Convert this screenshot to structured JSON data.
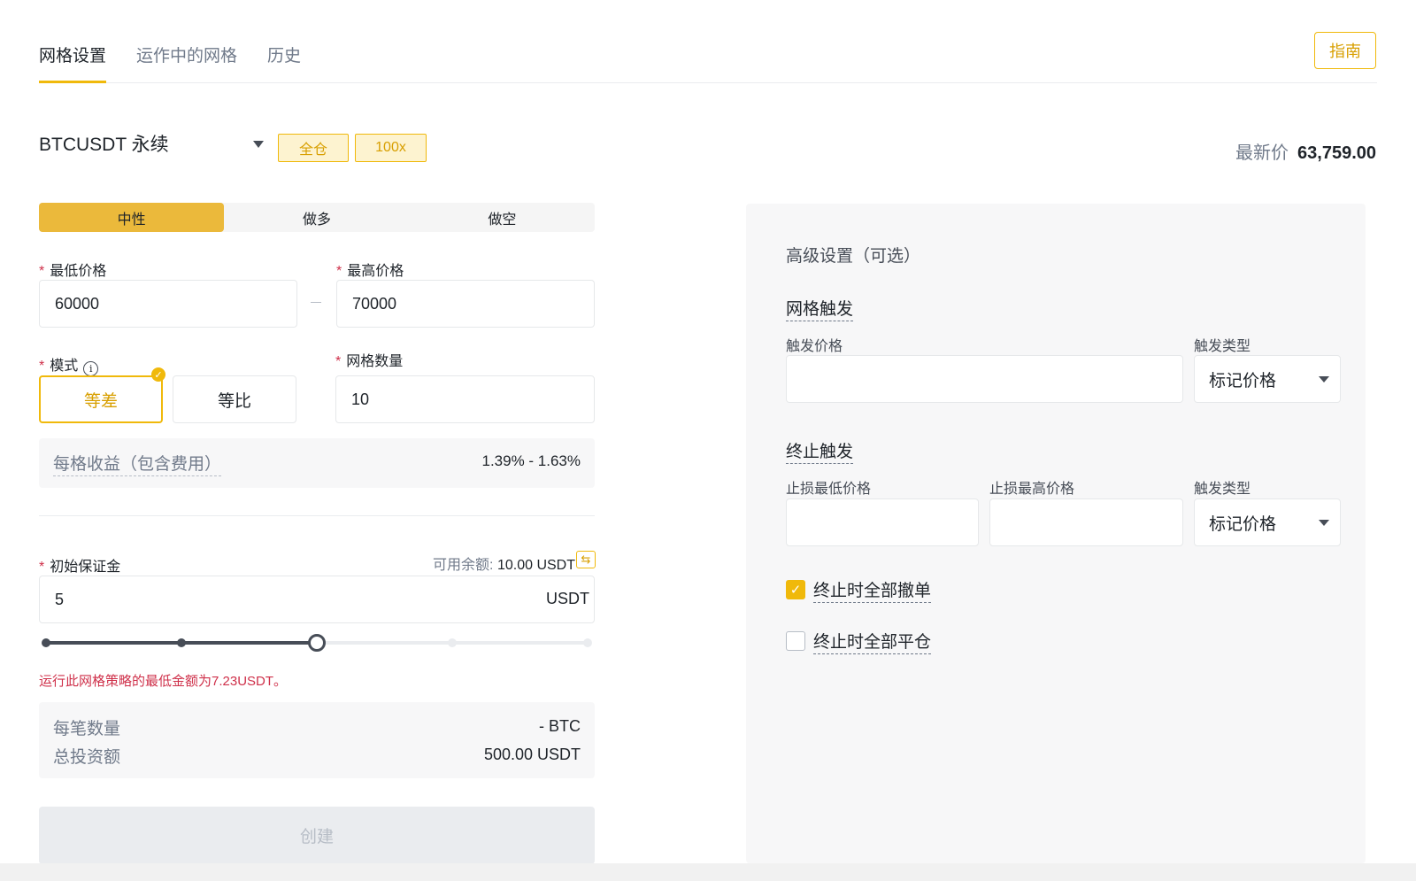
{
  "tabs": [
    {
      "label": "网格设置"
    },
    {
      "label": "运作中的网格"
    },
    {
      "label": "历史"
    }
  ],
  "guide_button": "指南",
  "symbol": {
    "name": "BTCUSDT 永续",
    "margin_mode": "全仓",
    "leverage": "100x"
  },
  "last_price": {
    "label": "最新价",
    "value": "63,759.00"
  },
  "direction": [
    {
      "label": "中性",
      "active": true
    },
    {
      "label": "做多",
      "active": false
    },
    {
      "label": "做空",
      "active": false
    }
  ],
  "price_range": {
    "lower_label": "最低价格",
    "lower_value": "60000",
    "upper_label": "最高价格",
    "upper_value": "70000"
  },
  "mode": {
    "label": "模式",
    "info_icon": "i",
    "options": [
      {
        "label": "等差",
        "active": true
      },
      {
        "label": "等比",
        "active": false
      }
    ]
  },
  "grid_count": {
    "label": "网格数量",
    "value": "10"
  },
  "profit": {
    "label": "每格收益（包含费用）",
    "value": "1.39% - 1.63%"
  },
  "margin": {
    "label": "初始保证金",
    "available_label": "可用余额:",
    "available_value": "10.00 USDT",
    "value": "5",
    "unit": "USDT"
  },
  "slider": {
    "percent": 50,
    "marks": [
      0,
      25,
      50,
      75,
      100
    ]
  },
  "warning": "运行此网格策略的最低金额为7.23USDT。",
  "summary": [
    {
      "label": "每笔数量",
      "value": "- BTC"
    },
    {
      "label": "总投资额",
      "value": "500.00 USDT"
    }
  ],
  "create_button": "创建",
  "advanced": {
    "title": "高级设置（可选）",
    "grid_trigger": {
      "title": "网格触发",
      "trigger_price_label": "触发价格",
      "trigger_price_value": "",
      "trigger_type_label": "触发类型",
      "trigger_type_value": "标记价格"
    },
    "stop_trigger": {
      "title": "终止触发",
      "stop_low_label": "止损最低价格",
      "stop_low_value": "",
      "stop_high_label": "止损最高价格",
      "stop_high_value": "",
      "trigger_type_label": "触发类型",
      "trigger_type_value": "标记价格"
    },
    "options": [
      {
        "label": "终止时全部撤单",
        "checked": true
      },
      {
        "label": "终止时全部平仓",
        "checked": false
      }
    ]
  },
  "colors": {
    "accent": "#f0b90b",
    "error": "#cf304a"
  }
}
